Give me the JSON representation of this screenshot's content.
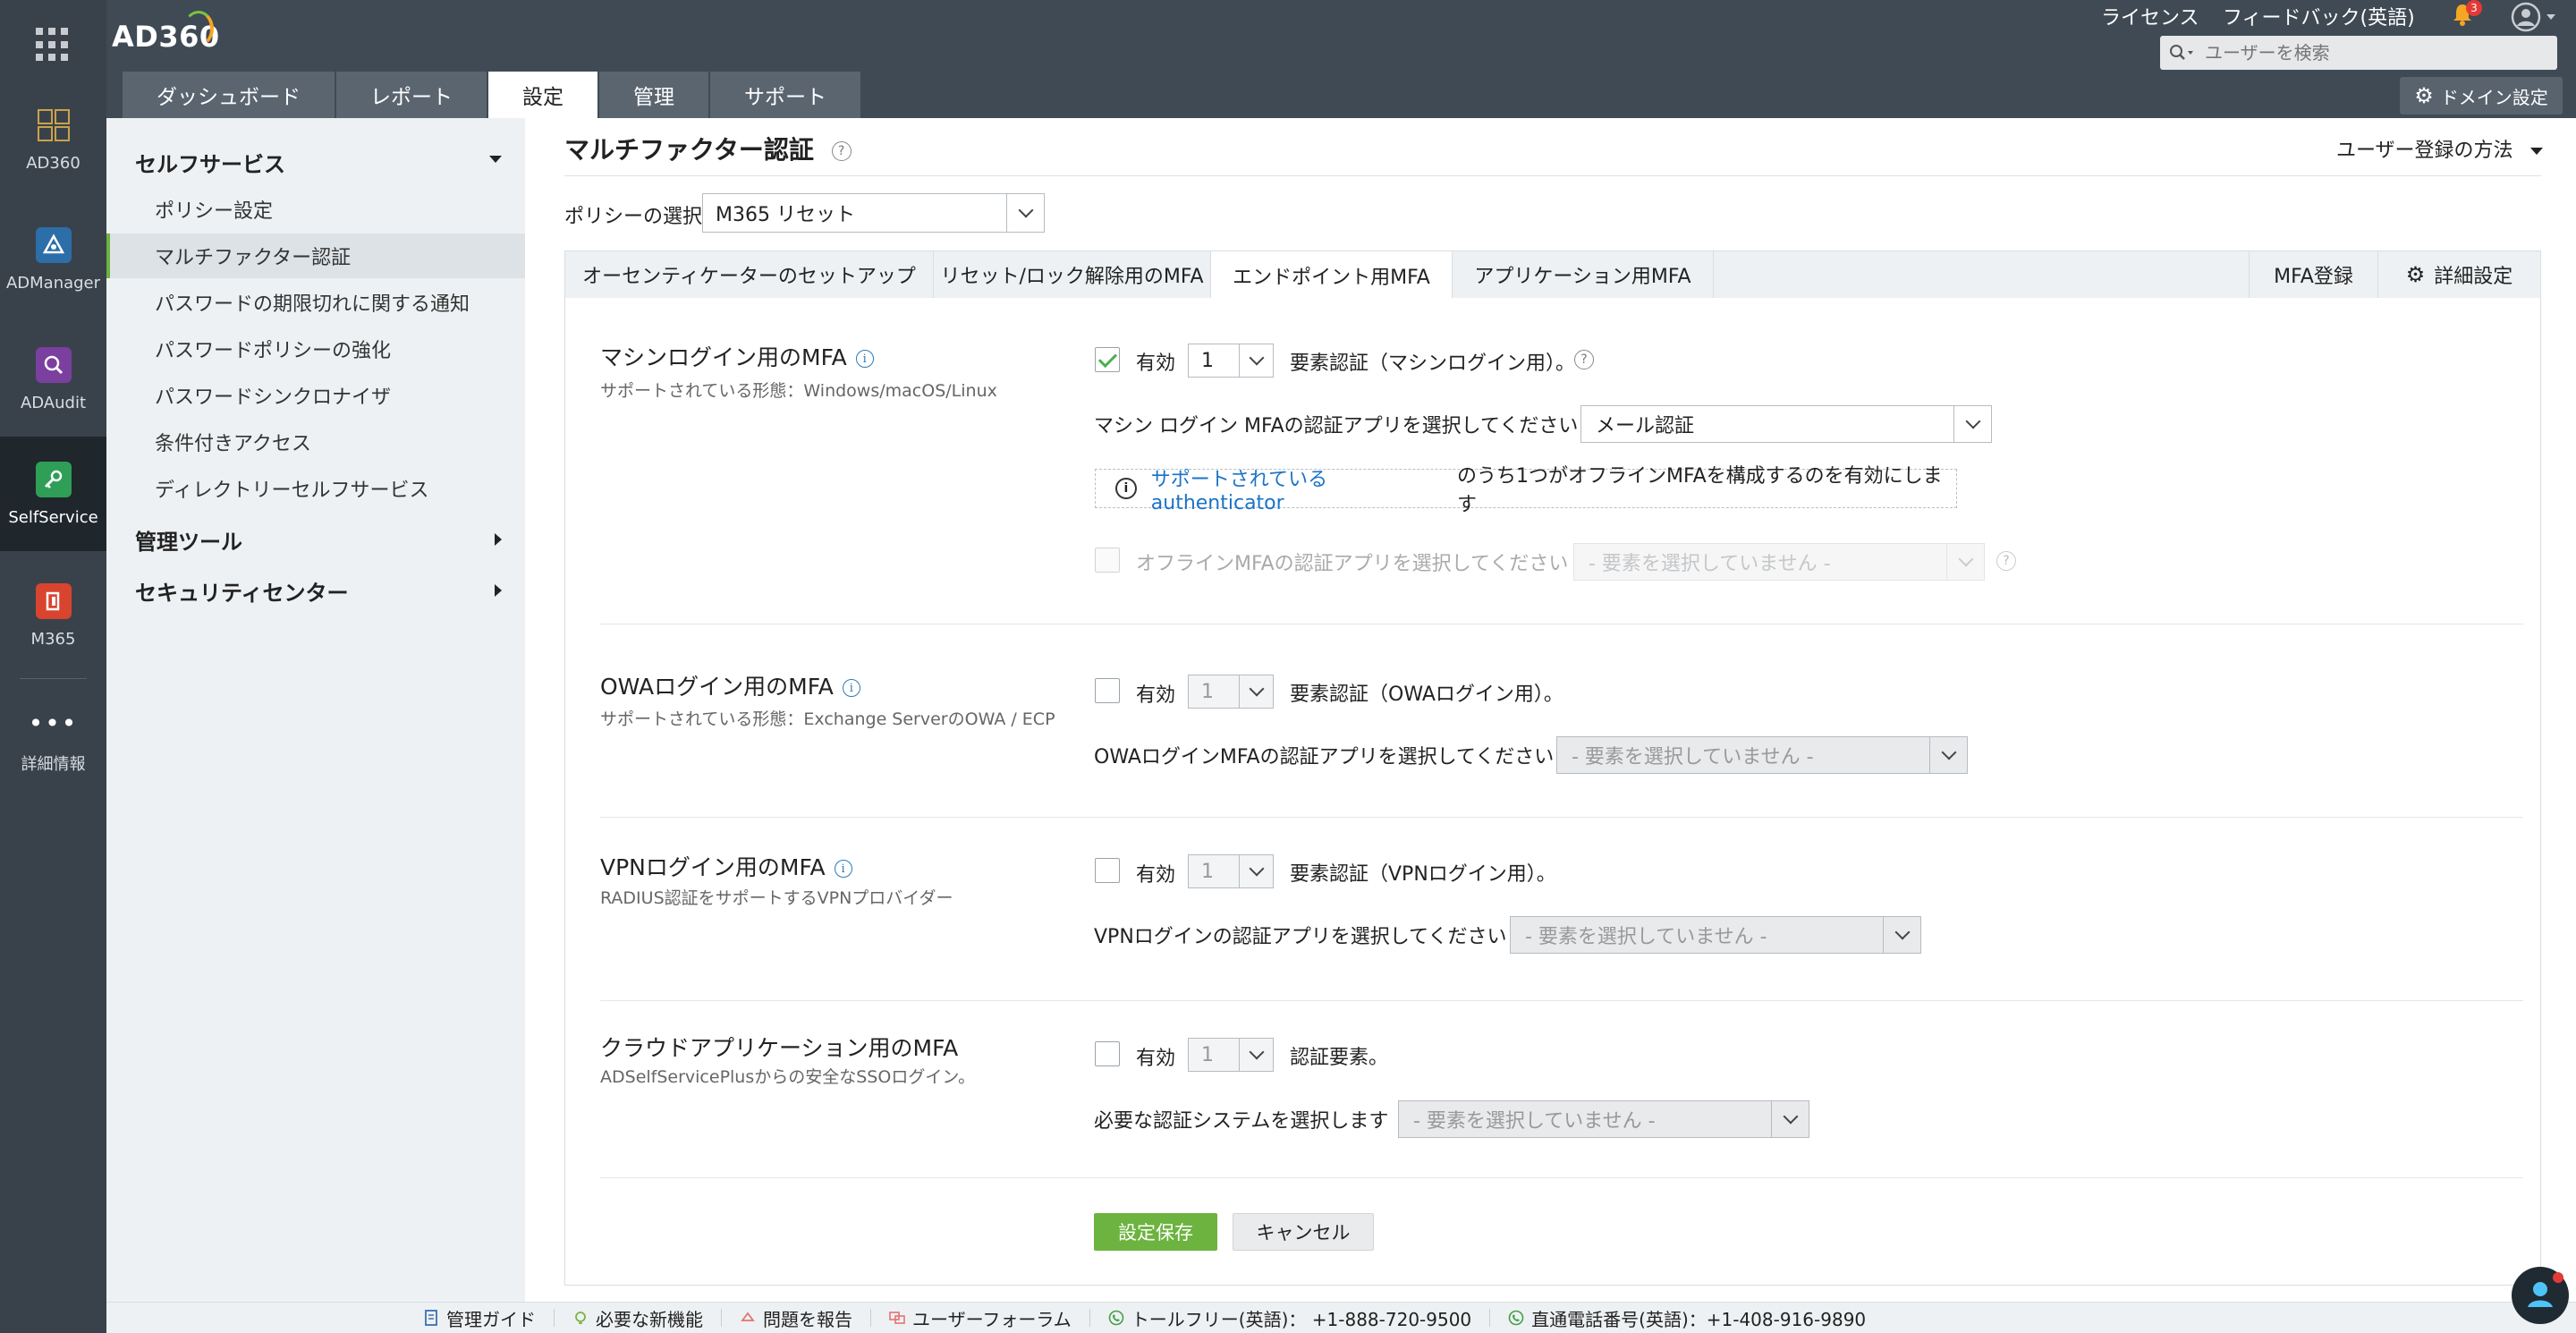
{
  "app": {
    "logo": "AD360"
  },
  "rail": {
    "items": [
      {
        "label": "AD360",
        "icon": "grid-modules-icon"
      },
      {
        "label": "ADManager",
        "icon": "admanager-icon"
      },
      {
        "label": "ADAudit",
        "icon": "adaudit-icon"
      },
      {
        "label": "SelfService",
        "icon": "key-icon"
      },
      {
        "label": "M365",
        "icon": "office-icon"
      },
      {
        "label": "詳細情報",
        "icon": "more-dots-icon"
      }
    ]
  },
  "header": {
    "license": "ライセンス",
    "feedback": "フィードバック(英語)",
    "notification_count": "3",
    "search_placeholder": "ユーザーを検索",
    "domain_settings": "ドメイン設定",
    "tabs": [
      "ダッシュボード",
      "レポート",
      "設定",
      "管理",
      "サポート"
    ]
  },
  "sidebar": {
    "section1": "セルフサービス",
    "items": [
      "ポリシー設定",
      "マルチファクター認証",
      "パスワードの期限切れに関する通知",
      "パスワードポリシーの強化",
      "パスワードシンクロナイザ",
      "条件付きアクセス",
      "ディレクトリーセルフサービス"
    ],
    "section2": "管理ツール",
    "section3": "セキュリティセンター"
  },
  "main": {
    "title": "マルチファクター認証",
    "reg_method": "ユーザー登録の方法",
    "policy_label": "ポリシーの選択",
    "policy_value": "M365 リセット",
    "tabs": [
      "オーセンティケーターのセットアップ",
      "リセット/ロック解除用のMFA",
      "エンドポイント用MFA",
      "アプリケーション用MFA"
    ],
    "right_tabs": [
      "MFA登録",
      "詳細設定"
    ]
  },
  "sections": {
    "machine": {
      "title": "マシンログイン用のMFA",
      "subtitle": "サポートされている形態：Windows/macOS/Linux",
      "enabled_label": "有効",
      "count": "1",
      "factor_text": "要素認証（マシンログイン用）。",
      "app_label": "マシン ログイン MFAの認証アプリを選択してください",
      "app_value": "メール認証",
      "note_link": "サポートされているauthenticator",
      "note_text": "のうち1つがオフラインMFAを構成するのを有効にします",
      "offline_label": "オフラインMFAの認証アプリを選択してください",
      "offline_value": "- 要素を選択していません -"
    },
    "owa": {
      "title": "OWAログイン用のMFA",
      "subtitle": "サポートされている形態：Exchange ServerのOWA / ECP",
      "enabled_label": "有効",
      "count": "1",
      "factor_text": "要素認証（OWAログイン用）。",
      "app_label": "OWAログインMFAの認証アプリを選択してください",
      "app_value": "- 要素を選択していません -"
    },
    "vpn": {
      "title": "VPNログイン用のMFA",
      "subtitle": "RADIUS認証をサポートするVPNプロバイダー",
      "enabled_label": "有効",
      "count": "1",
      "factor_text": "要素認証（VPNログイン用）。",
      "app_label": "VPNログインの認証アプリを選択してください",
      "app_value": "- 要素を選択していません -"
    },
    "cloud": {
      "title": "クラウドアプリケーション用のMFA",
      "subtitle": "ADSelfServicePlusからの安全なSSOログイン。",
      "enabled_label": "有効",
      "count": "1",
      "factor_text": "認証要素。",
      "app_label": "必要な認証システムを選択します",
      "app_value": "- 要素を選択していません -"
    }
  },
  "actions": {
    "save": "設定保存",
    "cancel": "キャンセル"
  },
  "footer": {
    "items": [
      "管理ガイド",
      "必要な新機能",
      "問題を報告",
      "ユーザーフォーラム",
      "トールフリー(英語)： +1-888-720-9500",
      "直通電話番号(英語)：+1-408-916-9890"
    ]
  },
  "colors": {
    "accent": "#6cb33f",
    "header": "#3f4a54",
    "rail": "#39424b",
    "link": "#1a73c8"
  }
}
